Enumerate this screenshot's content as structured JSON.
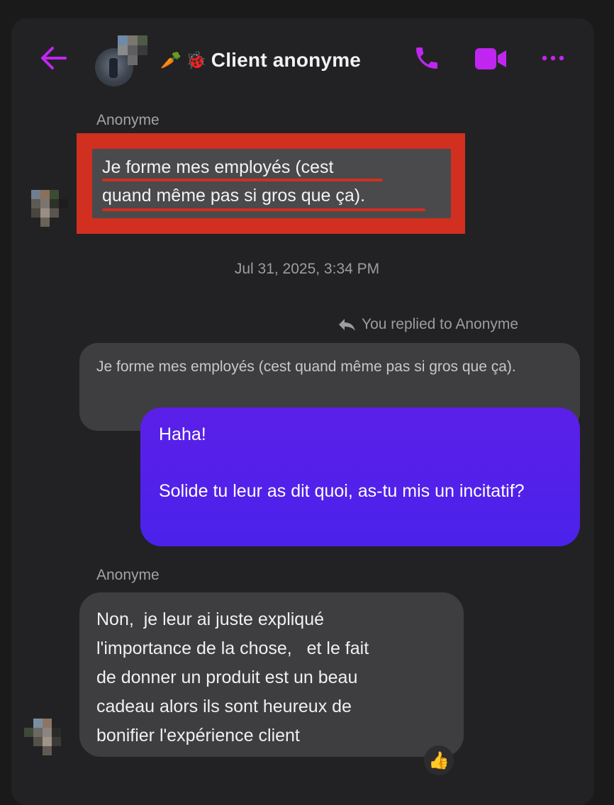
{
  "header": {
    "title": "Client anonyme",
    "title_emojis": [
      "🥕",
      "🐞"
    ],
    "back_icon": "arrow-left-icon",
    "call_icon": "phone-icon",
    "video_icon": "video-camera-icon",
    "more_icon": "more-horizontal-icon",
    "accent_color": "#c026f0"
  },
  "messages": {
    "first": {
      "sender": "Anonyme",
      "lines": [
        "Je forme mes employés (cest",
        "quand même pas si gros que ça)."
      ]
    },
    "timestamp": "Jul 31, 2025, 3:34 PM",
    "reply_note": "You replied to Anonyme",
    "quoted_text": "Je forme mes employés (cest quand même pas si gros que ça).",
    "my_reply": "Haha!\n\nSolide tu leur as dit quoi, as-tu mis un incitatif?",
    "second": {
      "sender": "Anonyme",
      "text": "Non,  je leur ai juste expliqué\nl'importance de la chose,   et le fait\nde donner un produit est un beau\ncadeau alors ils sont heureux de\nbonifier l'expérience client",
      "reaction": "👍"
    }
  },
  "colors": {
    "background": "#222224",
    "incoming_bubble": "#3e3e40",
    "outgoing_bubble": "#5b1fe9",
    "highlight": "#d12f1f"
  }
}
